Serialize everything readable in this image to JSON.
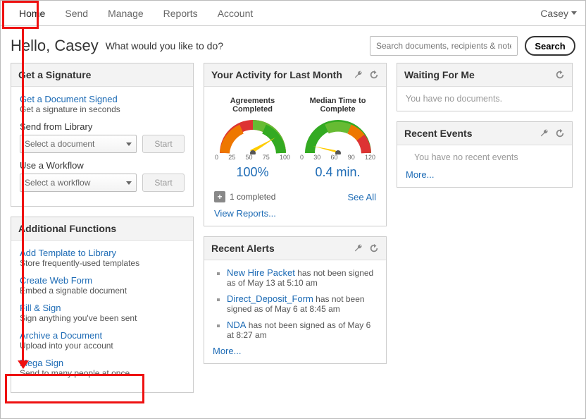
{
  "nav": {
    "items": [
      "Home",
      "Send",
      "Manage",
      "Reports",
      "Account"
    ],
    "user": "Casey"
  },
  "greeting": "Hello, Casey",
  "prompt": "What would you like to do?",
  "search": {
    "placeholder": "Search documents, recipients & notes",
    "button": "Search"
  },
  "panel_signature": {
    "title": "Get a Signature",
    "sign": {
      "link": "Get a Document Signed",
      "sub": "Get a signature in seconds"
    },
    "library": {
      "label": "Send from Library",
      "placeholder": "Select a document",
      "button": "Start"
    },
    "workflow": {
      "label": "Use a Workflow",
      "placeholder": "Select a workflow",
      "button": "Start"
    }
  },
  "panel_additional": {
    "title": "Additional Functions",
    "items": [
      {
        "link": "Add Template to Library",
        "sub": "Store frequently-used templates"
      },
      {
        "link": "Create Web Form",
        "sub": "Embed a signable document"
      },
      {
        "link": "Fill & Sign",
        "sub": "Sign anything you've been sent"
      },
      {
        "link": "Archive a Document",
        "sub": "Upload into your account"
      },
      {
        "link": "Mega Sign",
        "sub": "Send to many people at once"
      }
    ]
  },
  "panel_activity": {
    "title": "Your Activity for Last Month",
    "gauge1": {
      "title": "Agreements Completed",
      "ticks": [
        "0",
        "25",
        "50",
        "75",
        "100"
      ],
      "value": "100%"
    },
    "gauge2": {
      "title": "Median Time to Complete",
      "ticks": [
        "0",
        "30",
        "60",
        "90",
        "120"
      ],
      "value": "0.4 min."
    },
    "completed": "1 completed",
    "seeall": "See All",
    "viewreports": "View Reports..."
  },
  "panel_alerts": {
    "title": "Recent Alerts",
    "items": [
      {
        "link": "New Hire Packet",
        "rest": " has not been signed as of May 13 at 5:10 am"
      },
      {
        "link": "Direct_Deposit_Form",
        "rest": " has not been signed as of May 6 at 8:45 am"
      },
      {
        "link": "NDA",
        "rest": " has not been signed as of May 6 at 8:27 am"
      }
    ],
    "more": "More..."
  },
  "panel_waiting": {
    "title": "Waiting For Me",
    "empty": "You have no documents."
  },
  "panel_events": {
    "title": "Recent Events",
    "empty": "You have no recent events",
    "more": "More..."
  }
}
